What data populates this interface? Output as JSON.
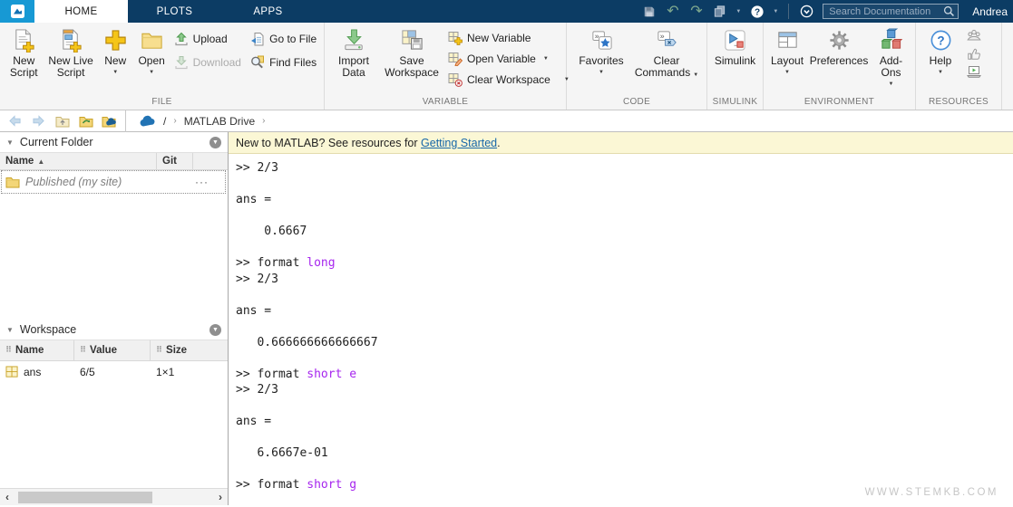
{
  "titlebar": {
    "tabs": [
      {
        "label": "HOME"
      },
      {
        "label": "PLOTS"
      },
      {
        "label": "APPS"
      }
    ],
    "active_tab": "HOME",
    "search_placeholder": "Search Documentation",
    "user_name": "Andrea"
  },
  "ribbon": {
    "sections": [
      {
        "label": "FILE"
      },
      {
        "label": "VARIABLE"
      },
      {
        "label": "CODE"
      },
      {
        "label": "SIMULINK"
      },
      {
        "label": "ENVIRONMENT"
      },
      {
        "label": "RESOURCES"
      }
    ],
    "buttons": {
      "new_script": "New Script",
      "new_live_script": "New Live Script",
      "new": "New",
      "open": "Open",
      "upload": "Upload",
      "download": "Download",
      "go_to_file": "Go to File",
      "find_files": "Find Files",
      "import_data": "Import Data",
      "save_workspace": "Save Workspace",
      "new_variable": "New Variable",
      "open_variable": "Open Variable",
      "clear_workspace": "Clear Workspace",
      "favorites": "Favorites",
      "clear_commands": "Clear Commands",
      "simulink": "Simulink",
      "layout": "Layout",
      "preferences": "Preferences",
      "add_ons": "Add-Ons",
      "help": "Help"
    }
  },
  "pathbar": {
    "root": "/",
    "separator": "›",
    "items": [
      "MATLAB Drive"
    ]
  },
  "current_folder": {
    "title": "Current Folder",
    "columns": {
      "name": "Name",
      "git": "Git"
    },
    "rows": [
      {
        "label": "Published (my site)",
        "menu": "···"
      }
    ]
  },
  "workspace": {
    "title": "Workspace",
    "columns": {
      "name": "Name",
      "value": "Value",
      "size": "Size"
    },
    "rows": [
      {
        "name": "ans",
        "value": "6/5",
        "size": "1×1"
      }
    ]
  },
  "notification": {
    "prefix": "New to MATLAB? See resources for ",
    "link": "Getting Started",
    "suffix": "."
  },
  "console": {
    "lines": [
      [
        {
          "t": ">> 2/3"
        }
      ],
      [],
      [
        {
          "t": "ans ="
        }
      ],
      [],
      [
        {
          "t": "    0.6667"
        }
      ],
      [],
      [
        {
          "t": ">> format "
        },
        {
          "t": "long",
          "k": 1
        }
      ],
      [
        {
          "t": ">> 2/3"
        }
      ],
      [],
      [
        {
          "t": "ans ="
        }
      ],
      [],
      [
        {
          "t": "   0.666666666666667"
        }
      ],
      [],
      [
        {
          "t": ">> format "
        },
        {
          "t": "short e",
          "k": 1
        }
      ],
      [
        {
          "t": ">> 2/3"
        }
      ],
      [],
      [
        {
          "t": "ans ="
        }
      ],
      [],
      [
        {
          "t": "   6.6667e-01"
        }
      ],
      [],
      [
        {
          "t": ">> format "
        },
        {
          "t": "short g",
          "k": 1
        }
      ]
    ]
  },
  "watermark": "WWW.STEMKB.COM",
  "colors": {
    "navy": "#0C3C64",
    "logo_blue": "#1799D4",
    "keyword": "#A625EE",
    "link": "#1767A8",
    "notification_bg": "#FBF7D5"
  }
}
